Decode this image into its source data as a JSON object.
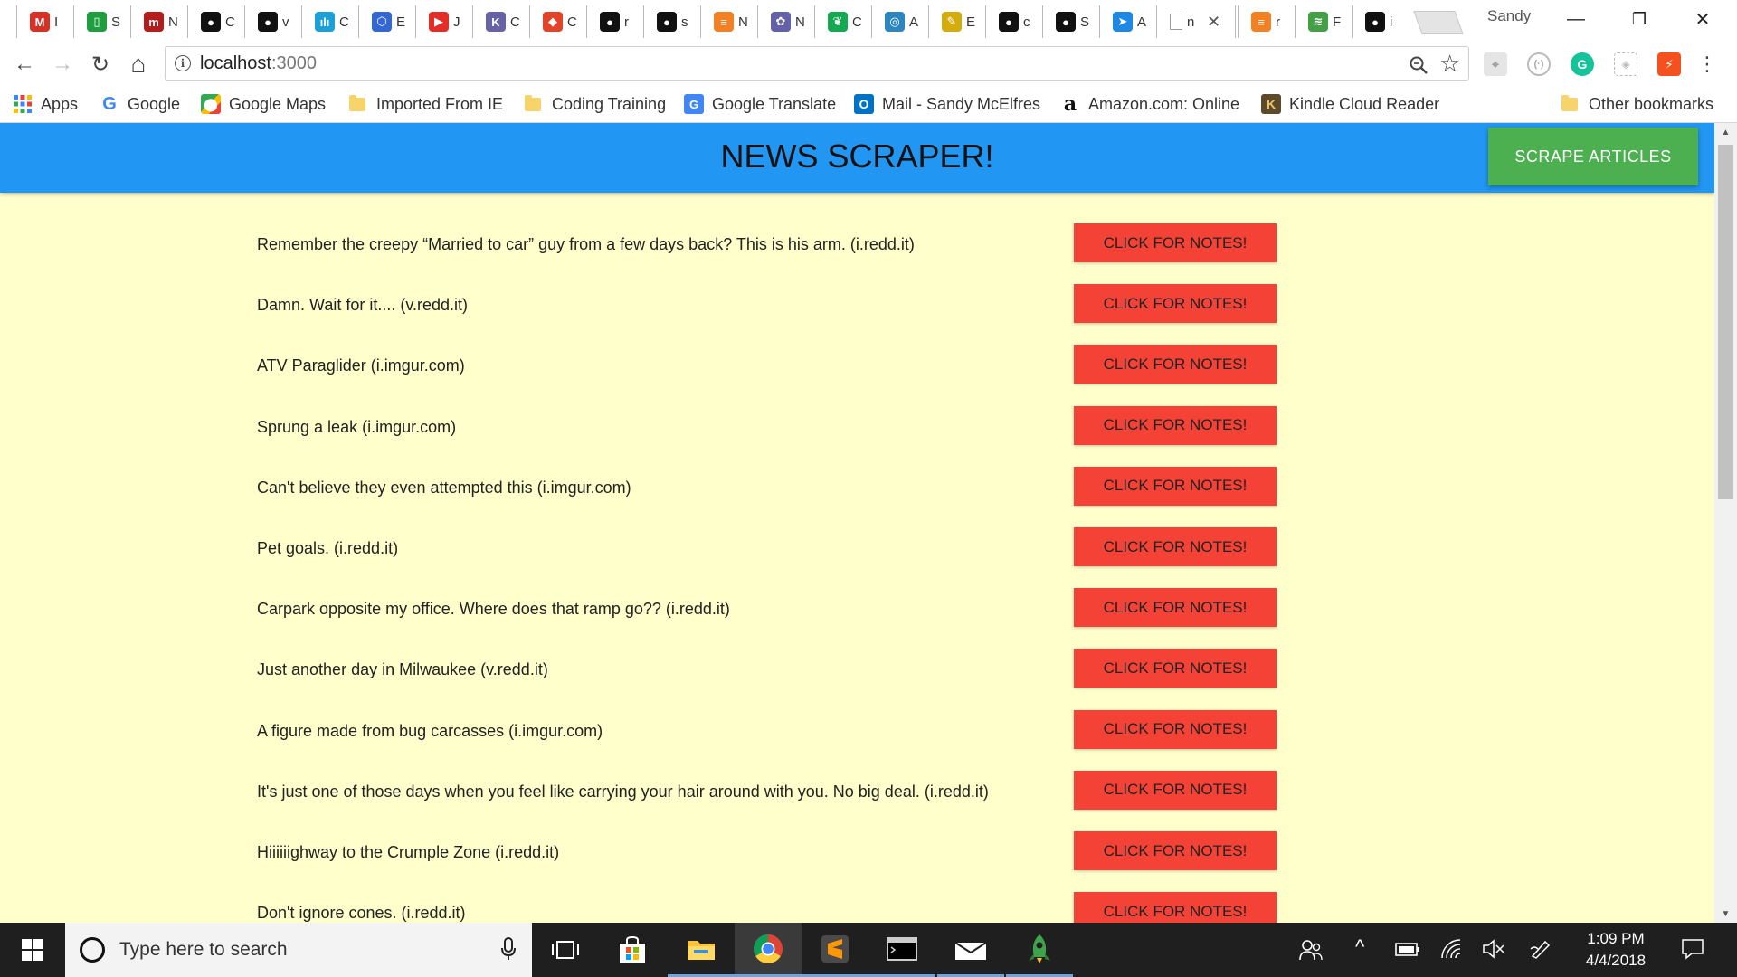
{
  "browser": {
    "tabs": [
      {
        "icon": "gmail-icon",
        "letter": "M",
        "color": "#d93025",
        "title": "I"
      },
      {
        "icon": "green-doc-icon",
        "letter": "▯",
        "color": "#1e9e3e",
        "title": "S"
      },
      {
        "icon": "m-icon",
        "letter": "m",
        "color": "#b71c1c",
        "title": "N"
      },
      {
        "icon": "github-icon",
        "letter": "●",
        "color": "#111111",
        "title": "C"
      },
      {
        "icon": "github-icon",
        "letter": "●",
        "color": "#111111",
        "title": "v"
      },
      {
        "icon": "cisco-icon",
        "letter": "ılı",
        "color": "#1ba0d7",
        "title": "C"
      },
      {
        "icon": "hexagon-icon",
        "letter": "⬡",
        "color": "#3367d6",
        "title": "E"
      },
      {
        "icon": "youtube-icon",
        "letter": "▶",
        "color": "#e52d27",
        "title": "J"
      },
      {
        "icon": "heroku-icon",
        "letter": "K",
        "color": "#6762a6",
        "title": "C"
      },
      {
        "icon": "gitlab-icon",
        "letter": "◆",
        "color": "#e24329",
        "title": "C"
      },
      {
        "icon": "github-icon",
        "letter": "●",
        "color": "#111111",
        "title": "r"
      },
      {
        "icon": "github-icon",
        "letter": "●",
        "color": "#111111",
        "title": "s"
      },
      {
        "icon": "stackoverflow-icon",
        "letter": "≡",
        "color": "#f48024",
        "title": "N"
      },
      {
        "icon": "nbc-icon",
        "letter": "✿",
        "color": "#6460aa",
        "title": "N"
      },
      {
        "icon": "mongodb-icon",
        "letter": "❦",
        "color": "#13aa52",
        "title": "C"
      },
      {
        "icon": "circle-badge-icon",
        "letter": "◎",
        "color": "#2e86c1",
        "title": "A"
      },
      {
        "icon": "pen-icon",
        "letter": "✎",
        "color": "#d4ac0d",
        "title": "E"
      },
      {
        "icon": "github-icon",
        "letter": "●",
        "color": "#111111",
        "title": "c"
      },
      {
        "icon": "github-icon",
        "letter": "●",
        "color": "#111111",
        "title": "S"
      },
      {
        "icon": "bird-icon",
        "letter": "➤",
        "color": "#1e88e5",
        "title": "A"
      }
    ],
    "active_tab": {
      "icon": "page-icon",
      "title": "n",
      "close": "✕"
    },
    "after_tabs": [
      {
        "icon": "stackoverflow-icon",
        "letter": "≡",
        "color": "#f48024",
        "title": "r"
      },
      {
        "icon": "green-square-icon",
        "letter": "≋",
        "color": "#43a047",
        "title": "F"
      },
      {
        "icon": "github-icon",
        "letter": "●",
        "color": "#111111",
        "title": "i"
      }
    ],
    "profile": "Sandy",
    "window_controls": {
      "minimize": "—",
      "restore": "❐",
      "close": "✕"
    },
    "nav": {
      "back": "←",
      "forward": "→",
      "reload": "↻",
      "home": "⌂"
    },
    "url": {
      "host": "localhost",
      "port": ":3000"
    },
    "omnibox_icons": {
      "zoom": "🔍",
      "star": "☆"
    },
    "bookmarks": [
      {
        "label": "Apps",
        "type": "apps"
      },
      {
        "label": "Google",
        "type": "google"
      },
      {
        "label": "Google Maps",
        "type": "maps"
      },
      {
        "label": "Imported From IE",
        "type": "folder"
      },
      {
        "label": "Coding Training",
        "type": "folder"
      },
      {
        "label": "Google Translate",
        "type": "translate"
      },
      {
        "label": "Mail - Sandy McElfres",
        "type": "outlook"
      },
      {
        "label": "Amazon.com: Online",
        "type": "amazon"
      },
      {
        "label": "Kindle Cloud Reader",
        "type": "kindle"
      }
    ],
    "other_bookmarks": "Other bookmarks"
  },
  "page": {
    "brand": "NEWS SCRAPER!",
    "scrape_button": "SCRAPE ARTICLES",
    "notes_button": "CLICK FOR NOTES!",
    "articles": [
      "Remember the creepy “Married to car” guy from a few days back? This is his arm. (i.redd.it)",
      "Damn. Wait for it.... (v.redd.it)",
      "ATV Paraglider (i.imgur.com)",
      "Sprung a leak (i.imgur.com)",
      "Can't believe they even attempted this (i.imgur.com)",
      "Pet goals. (i.redd.it)",
      "Carpark opposite my office. Where does that ramp go?? (i.redd.it)",
      "Just another day in Milwaukee (v.redd.it)",
      "A figure made from bug carcasses (i.imgur.com)",
      "It's just one of those days when you feel like carrying your hair around with you. No big deal. (i.redd.it)",
      "Hiiiiiighway to the Crumple Zone (i.redd.it)",
      "Don't ignore cones. (i.redd.it)"
    ]
  },
  "taskbar": {
    "search_placeholder": "Type here to search",
    "time": "1:09 PM",
    "date": "4/4/2018"
  },
  "colors": {
    "navbar": "#2196f3",
    "page_bg": "#ffffcc",
    "scrape_button": "#4caf50",
    "notes_button": "#f44336"
  }
}
